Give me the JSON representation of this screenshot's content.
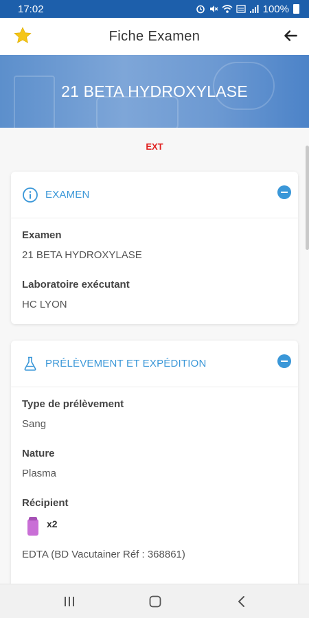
{
  "status_bar": {
    "time": "17:02",
    "battery": "100%"
  },
  "app_bar": {
    "title": "Fiche Examen"
  },
  "hero": {
    "title": "21 BETA HYDROXYLASE"
  },
  "tag": "EXT",
  "sections": {
    "examen": {
      "title": "EXAMEN",
      "fields": [
        {
          "label": "Examen",
          "value": "21 BETA HYDROXYLASE"
        },
        {
          "label": "Laboratoire exécutant",
          "value": "HC LYON"
        }
      ]
    },
    "prelevement": {
      "title": "PRÉLÈVEMENT ET EXPÉDITION",
      "fields": [
        {
          "label": "Type de prélèvement",
          "value": "Sang"
        },
        {
          "label": "Nature",
          "value": "Plasma"
        },
        {
          "label": "Récipient",
          "value": ""
        }
      ],
      "container_count": "x2",
      "container_description": "EDTA (BD Vacutainer Réf : 368861)"
    }
  },
  "colors": {
    "accent": "#3a97d8",
    "status_bar": "#1d5fab",
    "ext_tag": "#e0201f",
    "tube": "#c96fd6"
  },
  "icons": [
    "star-icon",
    "back-arrow-icon",
    "info-icon",
    "flask-icon",
    "recents-icon",
    "home-icon",
    "back-icon"
  ]
}
